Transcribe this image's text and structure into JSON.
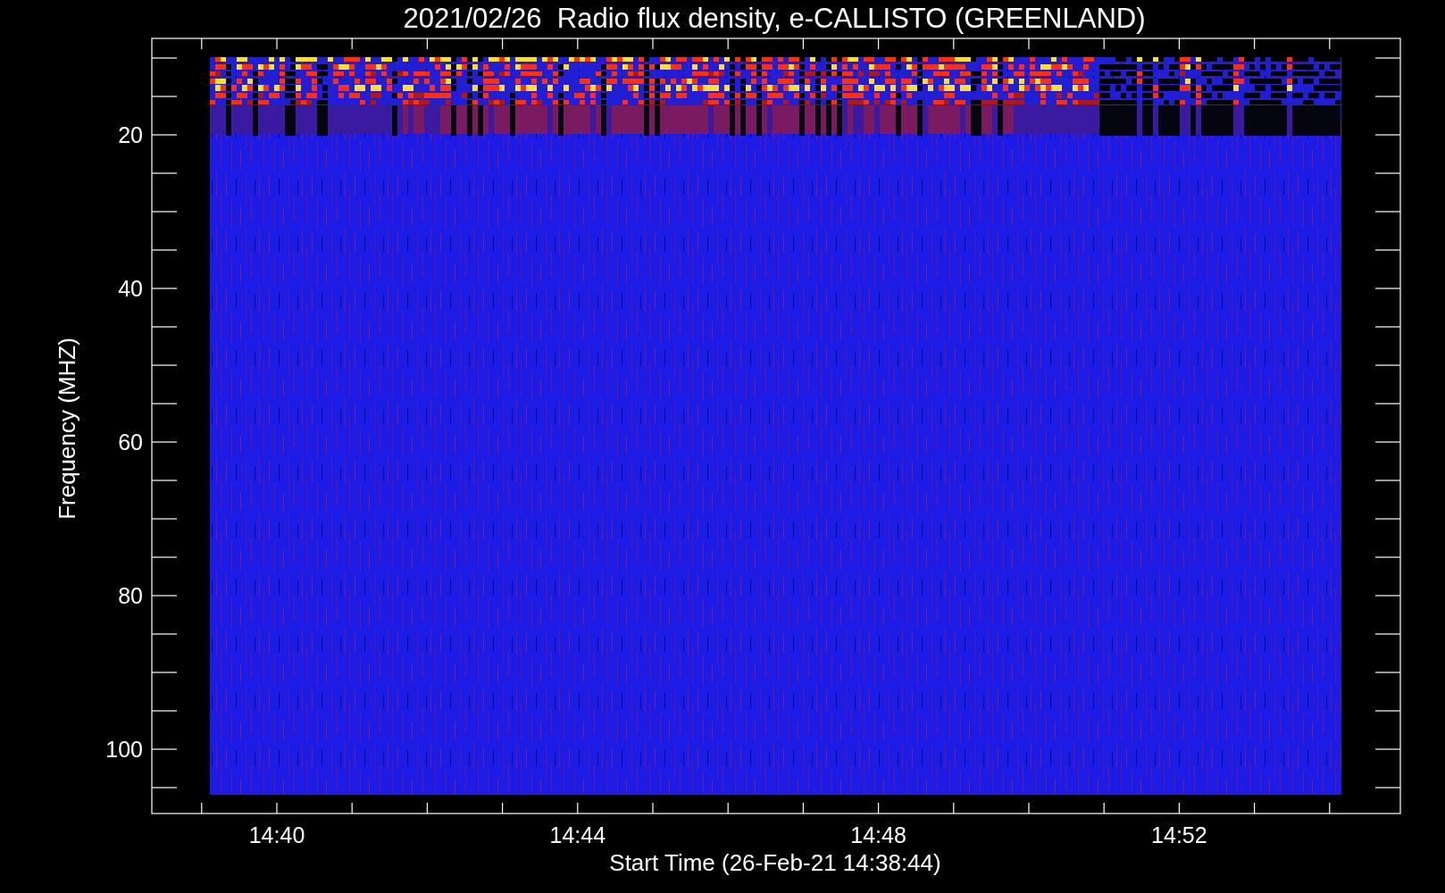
{
  "plot": {
    "title": "2021/02/26  Radio flux density, e-CALLISTO (GREENLAND)",
    "xlabel": "Start Time (26-Feb-21 14:38:44)",
    "ylabel": "Frequency (MHZ)",
    "xticks": [
      "14:40",
      "14:44",
      "14:48",
      "14:52"
    ],
    "yticks": [
      "20",
      "40",
      "60",
      "80",
      "100"
    ]
  }
}
